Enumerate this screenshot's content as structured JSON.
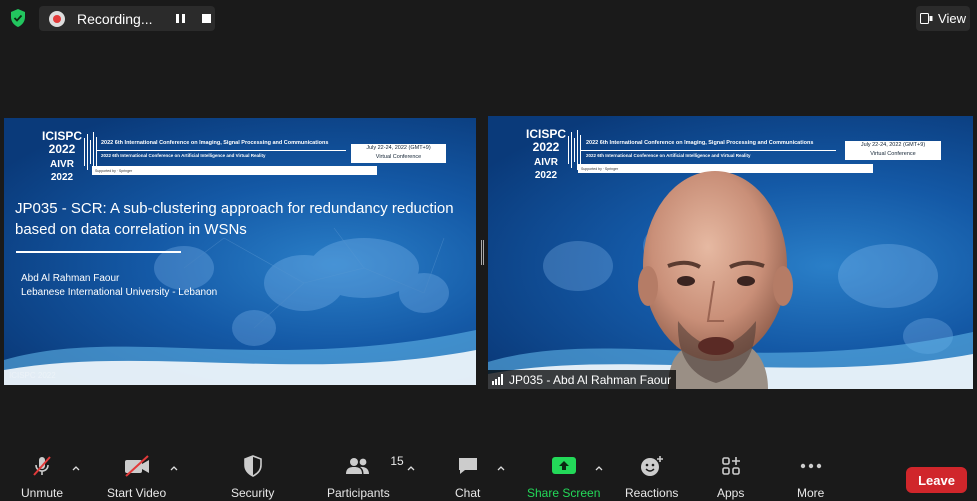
{
  "topbar": {
    "recording_label": "Recording...",
    "view_label": "View"
  },
  "left_slide": {
    "logo_top": "ICISPC",
    "logo_year": "2022",
    "logo_bottom": "AIVR",
    "logo_year2": "2022",
    "conf_line1": "2022 6th International Conference on Imaging, Signal Processing and Communications",
    "conf_line2": "2022 6th International Conference on Artificial Intelligence and Virtual Reality",
    "date": "July 22-24, 2022 (GMT+9)",
    "venue": "Virtual Conference",
    "title": "JP035 - SCR: A sub-clustering approach for redundancy reduction based on data correlation in WSNs",
    "author": "Abd Al Rahman Faour",
    "affiliation": "Lebanese International University - Lebanon",
    "watermark": "ICISPC 2022"
  },
  "right_video": {
    "logo_top": "ICISPC",
    "logo_year": "2022",
    "logo_bottom": "AIVR",
    "logo_year2": "2022",
    "conf_line1": "2022 6th International Conference on Imaging, Signal Processing and Communications",
    "conf_line2": "2022 6th International Conference on Artificial Intelligence and Virtual Reality",
    "date": "July 22-24, 2022 (GMT+9)",
    "venue": "Virtual Conference",
    "participant_name": "JP035 - Abd Al Rahman Faour"
  },
  "toolbar": {
    "unmute": "Unmute",
    "start_video": "Start Video",
    "security": "Security",
    "participants": "Participants",
    "participants_count": "15",
    "chat": "Chat",
    "share_screen": "Share Screen",
    "reactions": "Reactions",
    "apps": "Apps",
    "more": "More",
    "leave": "Leave"
  },
  "colors": {
    "background": "#1a1a1a",
    "share_green": "#23d959",
    "leave_red": "#d0262b",
    "muted_red": "#e23a3a",
    "shield_green": "#22c55e"
  }
}
